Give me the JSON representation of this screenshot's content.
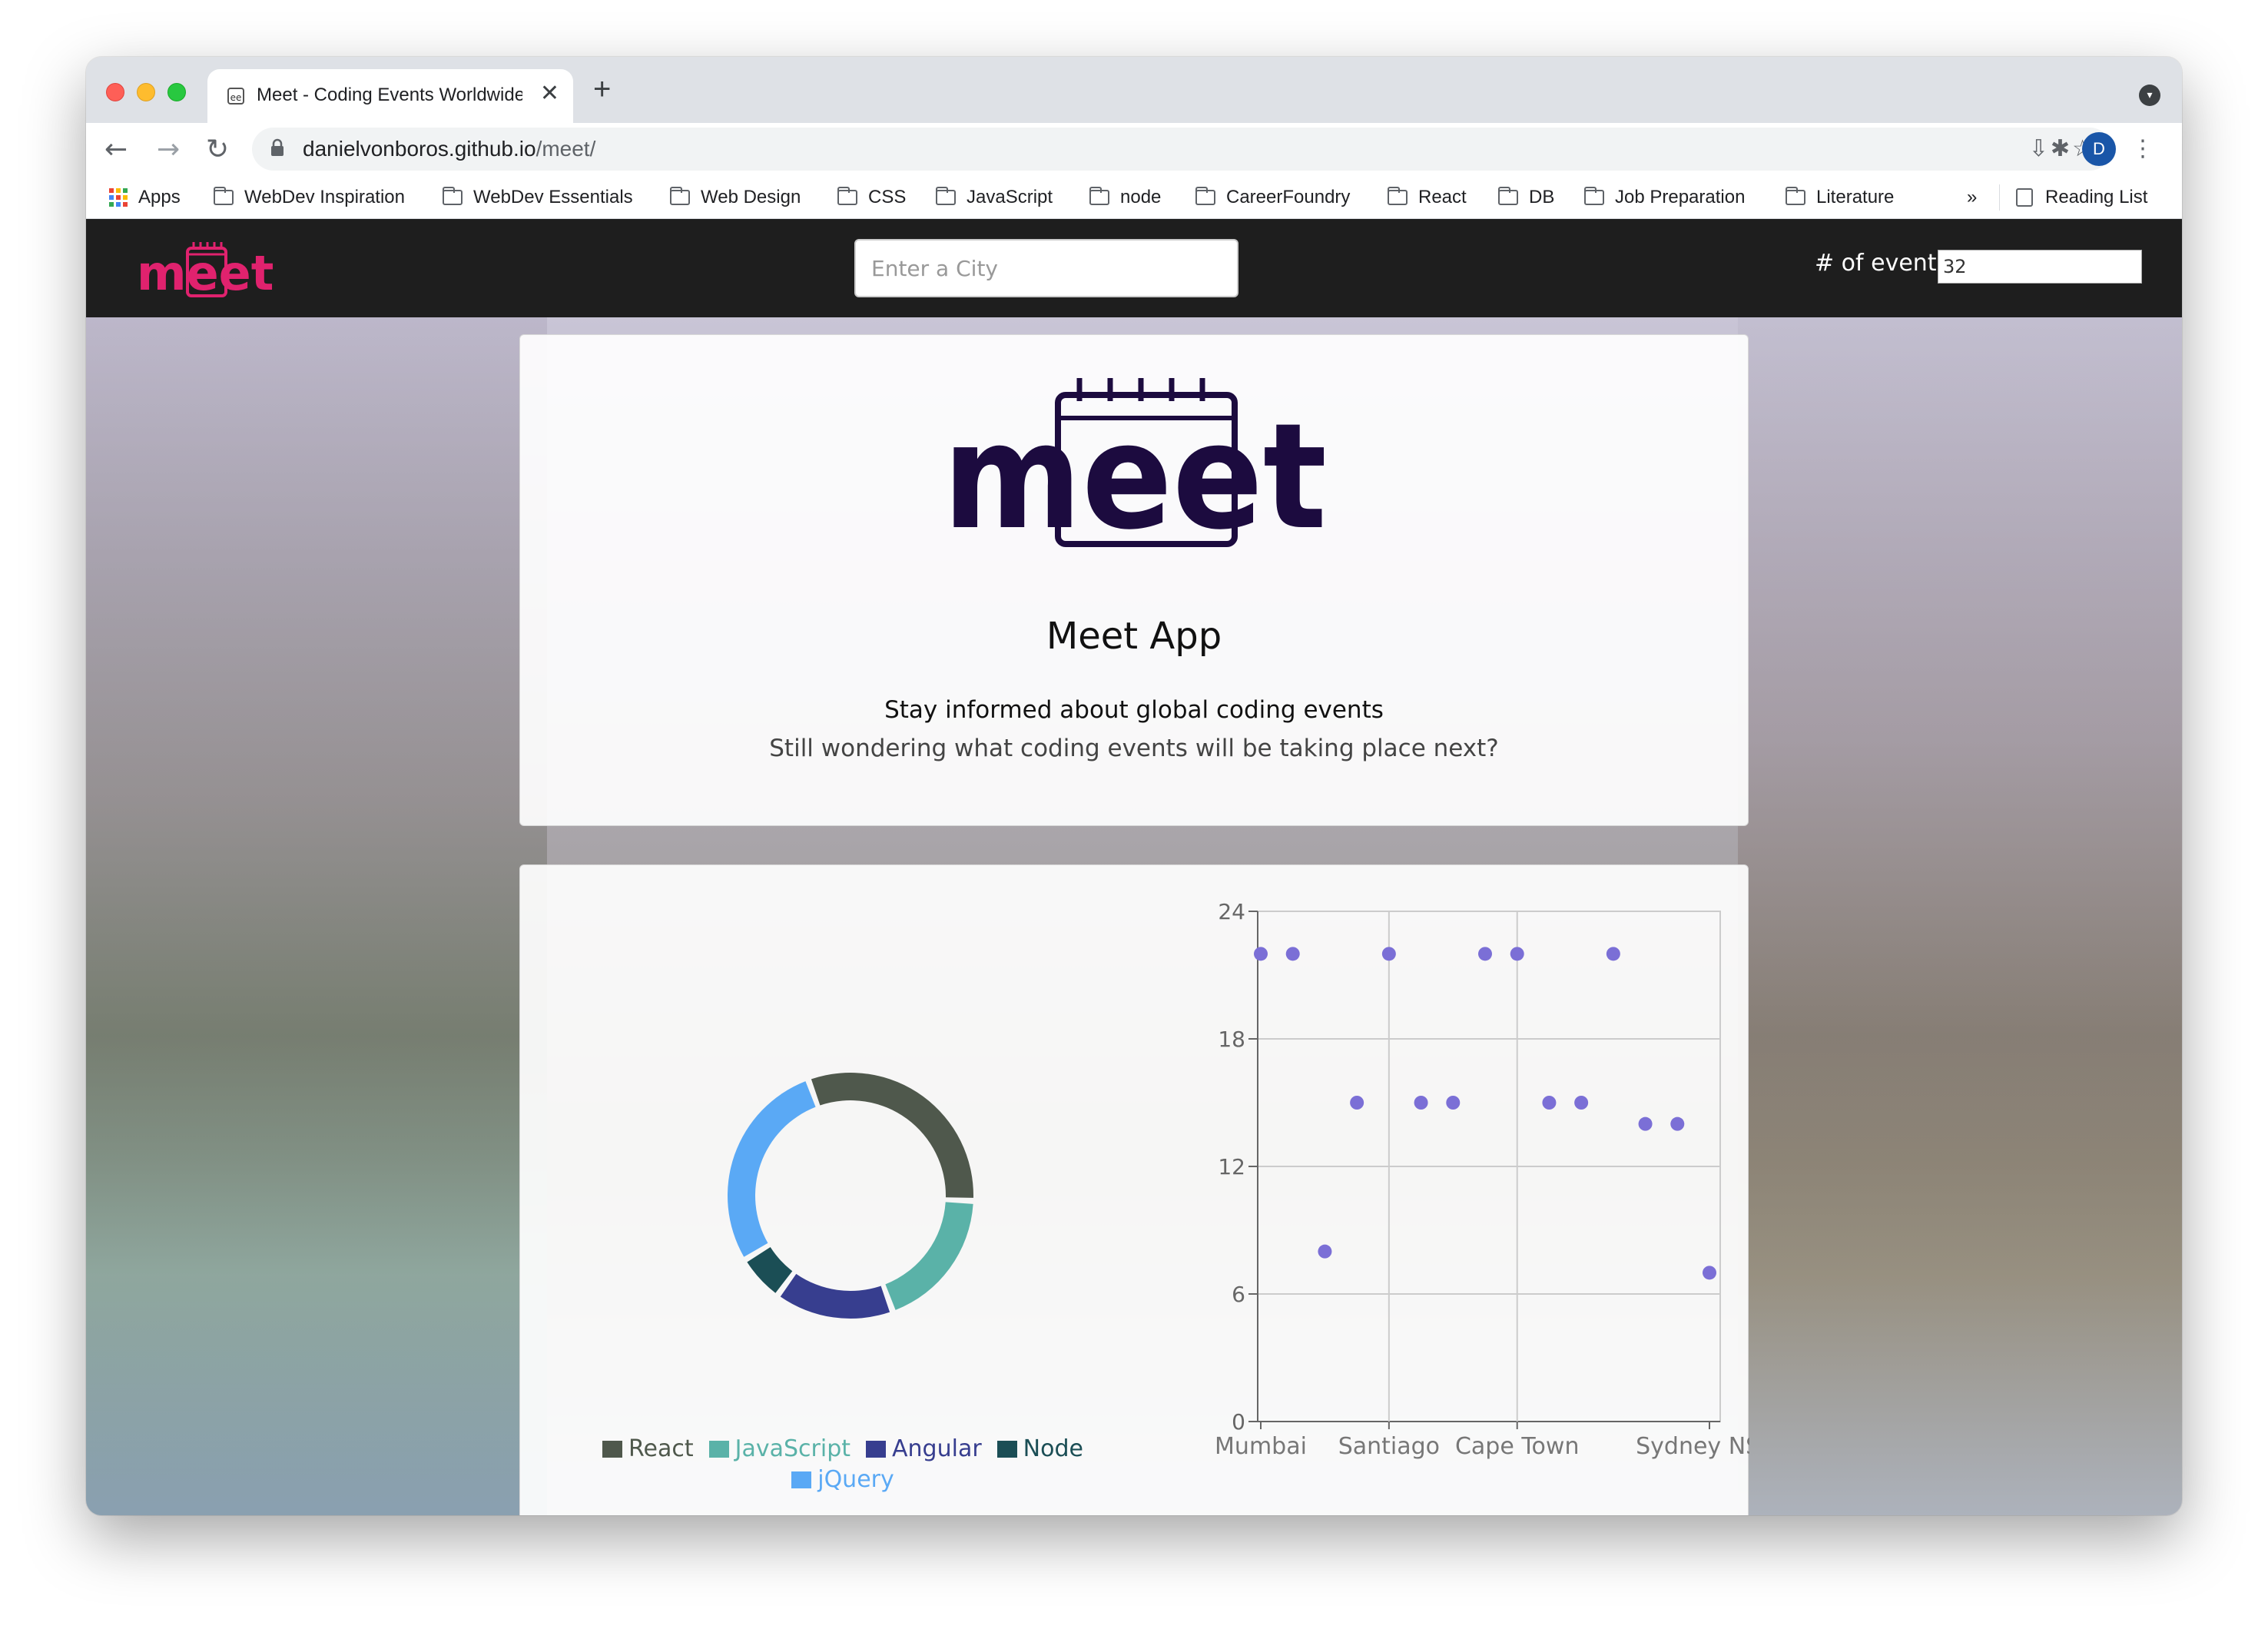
{
  "browser": {
    "tab_title": "Meet - Coding Events Worldwide",
    "tab_favicon": "ee",
    "new_tab_label": "+",
    "url_domain": "danielvonboros.github.io",
    "url_path": "/meet/",
    "profile_initial": "D",
    "bookmarks": [
      "Apps",
      "WebDev Inspiration",
      "WebDev Essentials",
      "Web Design",
      "CSS",
      "JavaScript",
      "node",
      "CareerFoundry",
      "React",
      "DB",
      "Job Preparation",
      "Literature"
    ],
    "bookmarks_overflow": "»",
    "reading_list": "Reading List"
  },
  "header": {
    "logo_text": "meet",
    "city_placeholder": "Enter a City",
    "events_label": "# of events",
    "events_value": "32"
  },
  "intro": {
    "logo_text": "meet",
    "title": "Meet App",
    "tagline": "Stay informed about global coding events",
    "subline": "Still wondering what coding events will be taking place next?"
  },
  "colors": {
    "header_bg": "#1e1e1e",
    "brand_pink": "#e0226e",
    "brand_dark": "#1c0b3f",
    "scatter_dot": "#7b6fd6"
  },
  "chart_data": [
    {
      "type": "pie",
      "labels": [
        "React",
        "JavaScript",
        "Angular",
        "Node",
        "jQuery"
      ],
      "values": [
        10,
        6,
        5,
        2,
        9
      ],
      "colors": [
        "#4f584c",
        "#5ab2a8",
        "#373e8f",
        "#1b4e55",
        "#5aa9f5"
      ],
      "legend": "bottom"
    },
    {
      "type": "scatter",
      "categories": [
        "Mumbai",
        "Santiago",
        "Cape Town",
        "Sydney NSW"
      ],
      "x_tick_labels": [
        "Mumbai",
        "Santiago",
        "Cape Town",
        "Sydney NSW"
      ],
      "y_ticks": [
        0,
        6,
        12,
        18,
        24
      ],
      "ylim": [
        0,
        24
      ],
      "grid": true,
      "points": [
        {
          "x": 0,
          "y": 22
        },
        {
          "x": 1,
          "y": 22
        },
        {
          "x": 2,
          "y": 8
        },
        {
          "x": 3,
          "y": 15
        },
        {
          "x": 4,
          "y": 22
        },
        {
          "x": 5,
          "y": 15
        },
        {
          "x": 6,
          "y": 15
        },
        {
          "x": 7,
          "y": 22
        },
        {
          "x": 8,
          "y": 22
        },
        {
          "x": 9,
          "y": 15
        },
        {
          "x": 10,
          "y": 15
        },
        {
          "x": 11,
          "y": 22
        },
        {
          "x": 12,
          "y": 14
        },
        {
          "x": 13,
          "y": 14
        },
        {
          "x": 14,
          "y": 7
        }
      ],
      "x_tick_positions": [
        0,
        4,
        8,
        14
      ]
    }
  ]
}
